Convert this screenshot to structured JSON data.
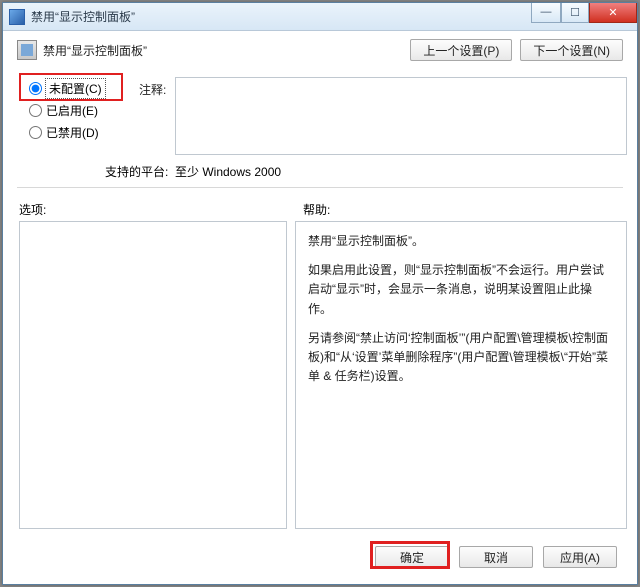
{
  "window": {
    "title": "禁用“显示控制面板”"
  },
  "header": {
    "title": "禁用“显示控制面板”",
    "prev": "上一个设置(P)",
    "next": "下一个设置(N)"
  },
  "radios": {
    "not_configured": "未配置(C)",
    "enabled": "已启用(E)",
    "disabled": "已禁用(D)"
  },
  "labels": {
    "comment": "注释:",
    "platform": "支持的平台:",
    "options": "选项:",
    "help": "帮助:"
  },
  "values": {
    "platform": "至少 Windows 2000"
  },
  "help": {
    "p1": "禁用“显示控制面板”。",
    "p2": "如果启用此设置，则“显示控制面板”不会运行。用户尝试启动“显示”时，会显示一条消息，说明某设置阻止此操作。",
    "p3": "另请参阅“禁止访问‘控制面板’”(用户配置\\管理模板\\控制面板)和“从‘设置’菜单删除程序”(用户配置\\管理模板\\“开始”菜单 & 任务栏)设置。"
  },
  "footer": {
    "ok": "确定",
    "cancel": "取消",
    "apply": "应用(A)"
  }
}
